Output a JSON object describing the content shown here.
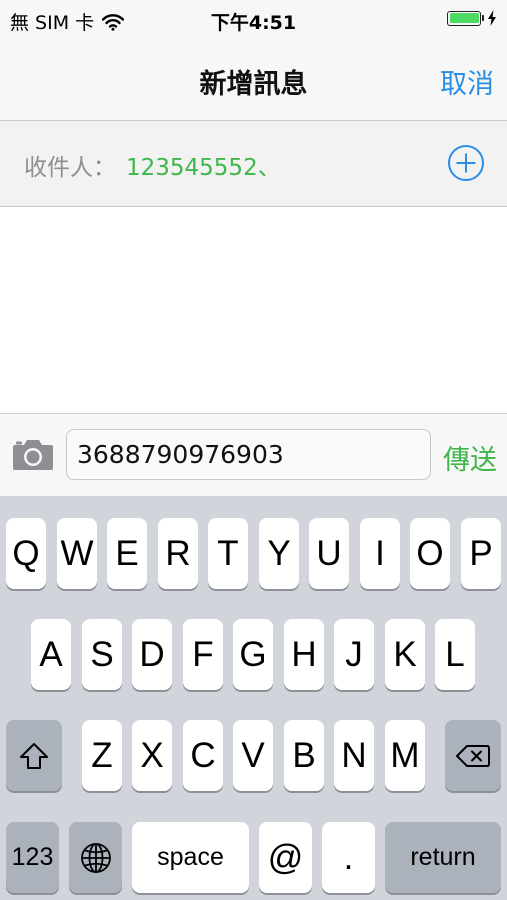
{
  "status_bar": {
    "carrier": "無 SIM 卡",
    "time": "下午4:51",
    "battery_level": 1.0
  },
  "nav": {
    "title": "新增訊息",
    "cancel_label": "取消"
  },
  "recipients": {
    "label": "收件人：",
    "value": "123545552、"
  },
  "compose": {
    "message_text": "3688790976903",
    "send_label": "傳送"
  },
  "keyboard": {
    "row1": [
      "Q",
      "W",
      "E",
      "R",
      "T",
      "Y",
      "U",
      "I",
      "O",
      "P"
    ],
    "row2": [
      "A",
      "S",
      "D",
      "F",
      "G",
      "H",
      "J",
      "K",
      "L"
    ],
    "row3": [
      "Z",
      "X",
      "C",
      "V",
      "B",
      "N",
      "M"
    ],
    "numbers_label": "123",
    "space_label": "space",
    "at_label": "@",
    "dot_label": ".",
    "return_label": "return"
  },
  "colors": {
    "accent_blue": "#2a8ee6",
    "accent_green": "#3fb64a",
    "battery_green": "#4cd964",
    "keyboard_bg": "#d1d5db"
  },
  "icons": {
    "wifi": "wifi-icon",
    "battery": "battery-icon",
    "charging": "bolt-icon",
    "add_contact": "plus-circle-icon",
    "camera": "camera-icon",
    "shift": "shift-icon",
    "globe": "globe-icon",
    "delete": "delete-icon"
  }
}
